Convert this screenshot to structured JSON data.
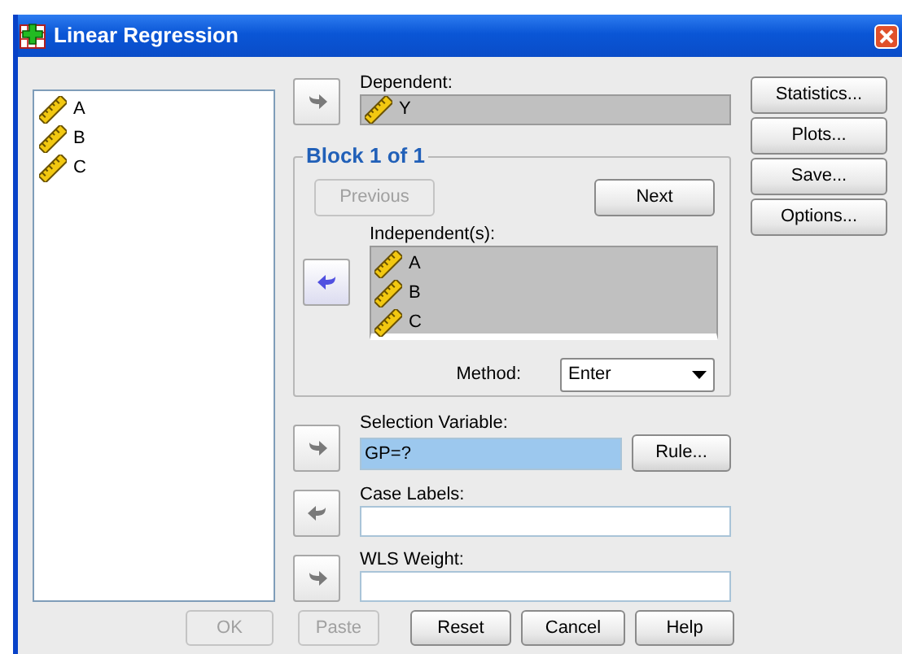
{
  "window": {
    "title": "Linear Regression"
  },
  "variables": [
    "A",
    "B",
    "C"
  ],
  "dependent": {
    "label": "Dependent:",
    "arrow": {
      "kind": "right",
      "active": false
    },
    "items": [
      "Y"
    ]
  },
  "block": {
    "title": "Block 1 of 1",
    "nav_buttons": [
      {
        "label": "Previous",
        "disabled": true
      },
      {
        "label": "Next",
        "disabled": false
      }
    ],
    "independent": {
      "label": "Independent(s):",
      "arrow": {
        "kind": "left",
        "active": true
      },
      "items": [
        "A",
        "B",
        "C"
      ]
    },
    "method": {
      "label": "Method:",
      "value": "Enter"
    }
  },
  "selection_variable": {
    "label": "Selection Variable:",
    "arrow": {
      "kind": "right",
      "active": false
    },
    "value": "GP=?",
    "selected": true,
    "button": "Rule..."
  },
  "case_labels": {
    "label": "Case Labels:",
    "arrow": {
      "kind": "left",
      "active": false
    }
  },
  "wls_weight": {
    "label": "WLS Weight:",
    "arrow": {
      "kind": "right",
      "active": false
    }
  },
  "side_buttons": [
    "Statistics...",
    "Plots...",
    "Save...",
    "Options..."
  ],
  "buttons": [
    {
      "label": "OK",
      "disabled": true
    },
    {
      "label": "Paste",
      "disabled": true
    },
    {
      "label": "Reset",
      "disabled": false
    },
    {
      "label": "Cancel",
      "disabled": false
    },
    {
      "label": "Help",
      "disabled": false
    }
  ]
}
